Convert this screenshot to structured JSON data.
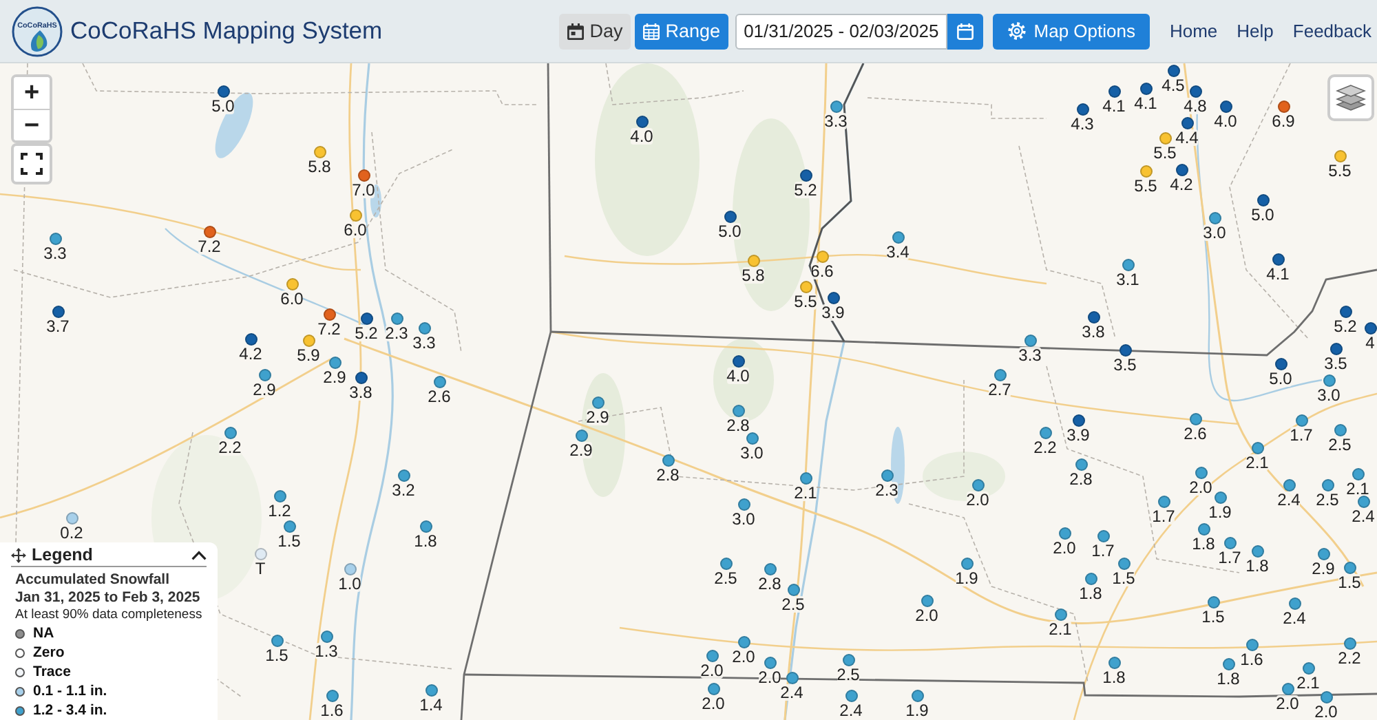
{
  "header": {
    "logo_text": "CoCoRaHS",
    "title": "CoCoRaHS Mapping System",
    "view_modes": [
      {
        "label": "Day",
        "selected": false
      },
      {
        "label": "Range",
        "selected": true
      }
    ],
    "date_range": "01/31/2025 - 02/03/2025",
    "map_options": "Map Options",
    "nav_links": [
      "Home",
      "Help",
      "Feedback"
    ]
  },
  "map": {
    "zoom_in": "+",
    "zoom_out": "−",
    "stations": [
      {
        "value": "4.5",
        "color": "#1660a6"
      },
      {
        "value": "5.0",
        "color": "#1660a6"
      },
      {
        "value": "4.1",
        "color": "#1660a6"
      },
      {
        "value": "4.1",
        "color": "#1660a6"
      },
      {
        "value": "4.8",
        "color": "#1660a6"
      },
      {
        "value": "3.3",
        "color": "#3fa1cd"
      },
      {
        "value": "4.3",
        "color": "#1660a6"
      },
      {
        "value": "4.0",
        "color": "#1660a6"
      },
      {
        "value": "6.9",
        "color": "#e1621d"
      },
      {
        "value": "4.0",
        "color": "#1660a6"
      },
      {
        "value": "4.4",
        "color": "#1660a6"
      },
      {
        "value": "5.5",
        "color": "#f8c231"
      },
      {
        "value": "5.8",
        "color": "#f8c231"
      },
      {
        "value": "5.5",
        "color": "#f8c231"
      },
      {
        "value": "7.0",
        "color": "#e1621d"
      },
      {
        "value": "5.2",
        "color": "#1660a6"
      },
      {
        "value": "5.5",
        "color": "#f8c231"
      },
      {
        "value": "4.2",
        "color": "#1660a6"
      },
      {
        "value": "5.0",
        "color": "#1660a6"
      },
      {
        "value": "6.0",
        "color": "#f8c231"
      },
      {
        "value": "5.0",
        "color": "#1660a6"
      },
      {
        "value": "3.0",
        "color": "#3fa1cd"
      },
      {
        "value": "3.3",
        "color": "#3fa1cd"
      },
      {
        "value": "7.2",
        "color": "#e1621d"
      },
      {
        "value": "3.4",
        "color": "#3fa1cd"
      },
      {
        "value": "5.8",
        "color": "#f8c231"
      },
      {
        "value": "6.6",
        "color": "#f8c231"
      },
      {
        "value": "3.1",
        "color": "#3fa1cd"
      },
      {
        "value": "4.1",
        "color": "#1660a6"
      },
      {
        "value": "6.0",
        "color": "#f8c231"
      },
      {
        "value": "5.5",
        "color": "#f8c231"
      },
      {
        "value": "3.9",
        "color": "#1660a6"
      },
      {
        "value": "3.7",
        "color": "#1660a6"
      },
      {
        "value": "7.2",
        "color": "#e1621d"
      },
      {
        "value": "5.2",
        "color": "#1660a6"
      },
      {
        "value": "2.3",
        "color": "#3fa1cd"
      },
      {
        "value": "3.8",
        "color": "#1660a6"
      },
      {
        "value": "5.2",
        "color": "#1660a6"
      },
      {
        "value": "3.3",
        "color": "#3fa1cd"
      },
      {
        "value": "4",
        "color": "#1660a6"
      },
      {
        "value": "4.2",
        "color": "#1660a6"
      },
      {
        "value": "5.9",
        "color": "#f8c231"
      },
      {
        "value": "3.3",
        "color": "#3fa1cd"
      },
      {
        "value": "3.5",
        "color": "#1660a6"
      },
      {
        "value": "3.5",
        "color": "#1660a6"
      },
      {
        "value": "2.9",
        "color": "#3fa1cd"
      },
      {
        "value": "4.0",
        "color": "#1660a6"
      },
      {
        "value": "5.0",
        "color": "#1660a6"
      },
      {
        "value": "2.9",
        "color": "#3fa1cd"
      },
      {
        "value": "3.8",
        "color": "#1660a6"
      },
      {
        "value": "2.6",
        "color": "#3fa1cd"
      },
      {
        "value": "2.7",
        "color": "#3fa1cd"
      },
      {
        "value": "3.0",
        "color": "#3fa1cd"
      },
      {
        "value": "2.9",
        "color": "#3fa1cd"
      },
      {
        "value": "2.8",
        "color": "#3fa1cd"
      },
      {
        "value": "3.9",
        "color": "#1660a6"
      },
      {
        "value": "2.6",
        "color": "#3fa1cd"
      },
      {
        "value": "1.7",
        "color": "#3fa1cd"
      },
      {
        "value": "2.2",
        "color": "#3fa1cd"
      },
      {
        "value": "2.9",
        "color": "#3fa1cd"
      },
      {
        "value": "3.0",
        "color": "#3fa1cd"
      },
      {
        "value": "2.2",
        "color": "#3fa1cd"
      },
      {
        "value": "2.5",
        "color": "#3fa1cd"
      },
      {
        "value": "2.1",
        "color": "#3fa1cd"
      },
      {
        "value": "2.8",
        "color": "#3fa1cd"
      },
      {
        "value": "2.8",
        "color": "#3fa1cd"
      },
      {
        "value": "3.2",
        "color": "#3fa1cd"
      },
      {
        "value": "2.1",
        "color": "#3fa1cd"
      },
      {
        "value": "2.3",
        "color": "#3fa1cd"
      },
      {
        "value": "2.0",
        "color": "#3fa1cd"
      },
      {
        "value": "2.1",
        "color": "#3fa1cd"
      },
      {
        "value": "2.0",
        "color": "#3fa1cd"
      },
      {
        "value": "2.4",
        "color": "#3fa1cd"
      },
      {
        "value": "2.5",
        "color": "#3fa1cd"
      },
      {
        "value": "1.2",
        "color": "#3fa1cd"
      },
      {
        "value": "3.0",
        "color": "#3fa1cd"
      },
      {
        "value": "1.7",
        "color": "#3fa1cd"
      },
      {
        "value": "1.9",
        "color": "#3fa1cd"
      },
      {
        "value": "2.4",
        "color": "#3fa1cd"
      },
      {
        "value": "0.2",
        "color": "#a8d0ea"
      },
      {
        "value": "1.5",
        "color": "#3fa1cd"
      },
      {
        "value": "1.8",
        "color": "#3fa1cd"
      },
      {
        "value": "2.0",
        "color": "#3fa1cd"
      },
      {
        "value": "1.7",
        "color": "#3fa1cd"
      },
      {
        "value": "1.8",
        "color": "#3fa1cd"
      },
      {
        "value": "1.7",
        "color": "#3fa1cd"
      },
      {
        "value": "T",
        "color": "#dfeaf3"
      },
      {
        "value": "1.8",
        "color": "#3fa1cd"
      },
      {
        "value": "2.9",
        "color": "#3fa1cd"
      },
      {
        "value": "1.0",
        "color": "#a8d0ea"
      },
      {
        "value": "2.5",
        "color": "#3fa1cd"
      },
      {
        "value": "2.8",
        "color": "#3fa1cd"
      },
      {
        "value": "1.9",
        "color": "#3fa1cd"
      },
      {
        "value": "1.5",
        "color": "#3fa1cd"
      },
      {
        "value": "1.5",
        "color": "#3fa1cd"
      },
      {
        "value": "1.8",
        "color": "#3fa1cd"
      },
      {
        "value": "2.5",
        "color": "#3fa1cd"
      },
      {
        "value": "2.0",
        "color": "#3fa1cd"
      },
      {
        "value": "1.5",
        "color": "#3fa1cd"
      },
      {
        "value": "2.4",
        "color": "#3fa1cd"
      },
      {
        "value": "2.1",
        "color": "#3fa1cd"
      },
      {
        "value": "1.5",
        "color": "#3fa1cd"
      },
      {
        "value": "1.3",
        "color": "#3fa1cd"
      },
      {
        "value": "2.0",
        "color": "#3fa1cd"
      },
      {
        "value": "1.6",
        "color": "#3fa1cd"
      },
      {
        "value": "2.2",
        "color": "#3fa1cd"
      },
      {
        "value": "2.0",
        "color": "#3fa1cd"
      },
      {
        "value": "2.0",
        "color": "#3fa1cd"
      },
      {
        "value": "2.5",
        "color": "#3fa1cd"
      },
      {
        "value": "1.8",
        "color": "#3fa1cd"
      },
      {
        "value": "1.8",
        "color": "#3fa1cd"
      },
      {
        "value": "2.1",
        "color": "#3fa1cd"
      },
      {
        "value": "2.4",
        "color": "#3fa1cd"
      },
      {
        "value": "1.6",
        "color": "#3fa1cd"
      },
      {
        "value": "1.4",
        "color": "#3fa1cd"
      },
      {
        "value": "2.0",
        "color": "#3fa1cd"
      },
      {
        "value": "2.4",
        "color": "#3fa1cd"
      },
      {
        "value": "1.9",
        "color": "#3fa1cd"
      },
      {
        "value": "2.0",
        "color": "#3fa1cd"
      },
      {
        "value": "2.0",
        "color": "#3fa1cd"
      }
    ]
  },
  "legend": {
    "title": "Legend",
    "expanded": true,
    "heading": "Accumulated Snowfall",
    "period": "Jan 31, 2025 to Feb 3, 2025",
    "note": "At least 90% data completeness",
    "items": [
      {
        "label": "NA",
        "color": "#8e8e8e"
      },
      {
        "label": "Zero",
        "color": "#ffffff"
      },
      {
        "label": "Trace",
        "color": "#f3f6f9"
      },
      {
        "label": "0.1 - 1.1 in.",
        "color": "#a8d0ea"
      },
      {
        "label": "1.2 - 3.4 in.",
        "color": "#3fa1cd"
      }
    ]
  }
}
